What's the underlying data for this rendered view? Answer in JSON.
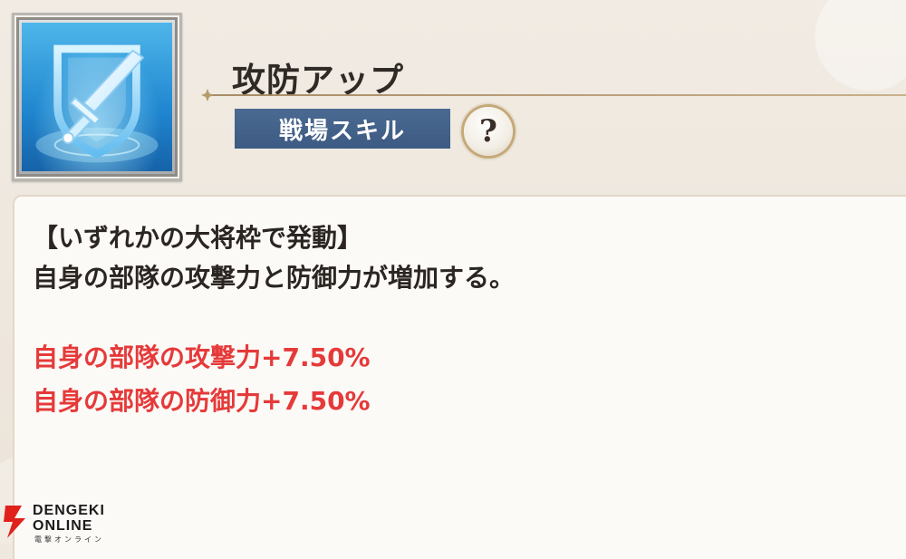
{
  "skill": {
    "name": "攻防アップ",
    "type_label": "戦場スキル",
    "help_symbol": "?",
    "icon": "sword-shield-icon"
  },
  "description": {
    "condition": "【いずれかの大将枠で発動】",
    "summary": "自身の部隊の攻撃力と防御力が増加する。",
    "effects": [
      "自身の部隊の攻撃力+7.50%",
      "自身の部隊の防御力+7.50%"
    ]
  },
  "watermark": {
    "line1": "DENGEKI",
    "line2": "ONLINE",
    "line3": "電撃オンライン"
  },
  "colors": {
    "effect_text": "#e53a3a",
    "badge": "#3f5e86",
    "icon_blue": "#1f86cf"
  }
}
